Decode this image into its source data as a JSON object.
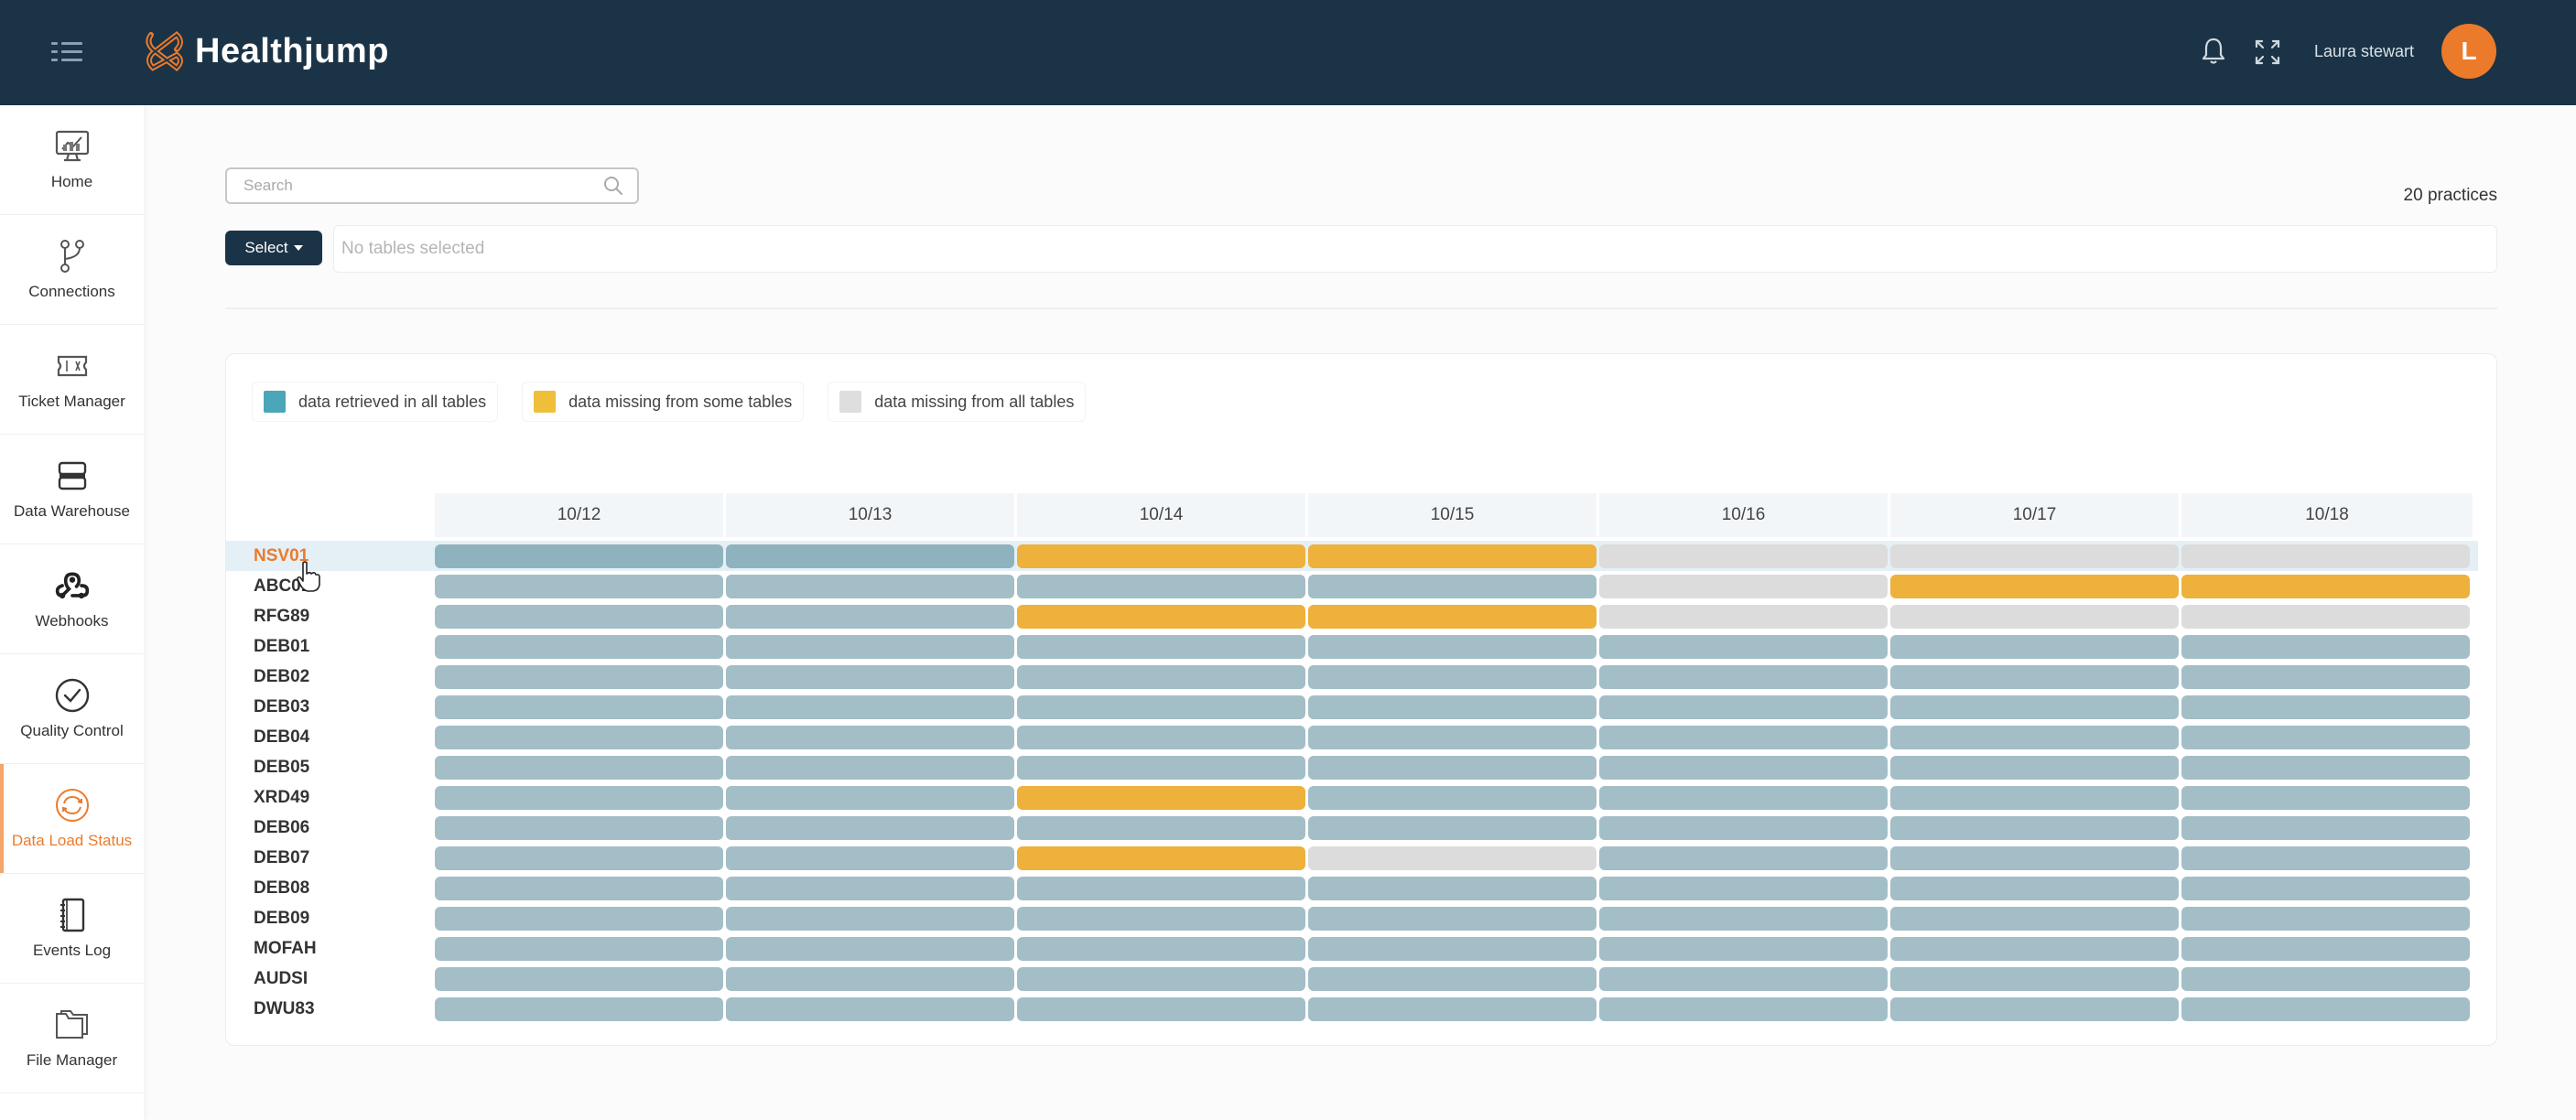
{
  "header": {
    "brand": "Healthjump",
    "user_name": "Laura stewart",
    "avatar_initial": "L",
    "icons": [
      "menu-icon",
      "bell-icon",
      "expand-icon"
    ]
  },
  "sidebar": {
    "items": [
      {
        "label": "Home",
        "icon": "monitor-chart-icon",
        "active": false
      },
      {
        "label": "Connections",
        "icon": "branch-icon",
        "active": false
      },
      {
        "label": "Ticket Manager",
        "icon": "ticket-icon",
        "active": false
      },
      {
        "label": "Data Warehouse",
        "icon": "server-icon",
        "active": false
      },
      {
        "label": "Webhooks",
        "icon": "webhook-icon",
        "active": false
      },
      {
        "label": "Quality Control",
        "icon": "check-circle-icon",
        "active": false
      },
      {
        "label": "Data Load Status",
        "icon": "sync-icon",
        "active": true
      },
      {
        "label": "Events Log",
        "icon": "notebook-icon",
        "active": false
      },
      {
        "label": "File Manager",
        "icon": "folder-icon",
        "active": false
      }
    ]
  },
  "toolbar": {
    "search_placeholder": "Search",
    "practice_count": "20 practices",
    "select_label": "Select",
    "tables_placeholder": "No tables selected"
  },
  "colors": {
    "brand_dark": "#1b3346",
    "accent": "#ec7a2b",
    "retrieved": "#a3bec7",
    "retrieved_legend": "#4aa6b8",
    "missing_some": "#edb13c",
    "missing_all": "#dcdcdc"
  },
  "legend": [
    {
      "key": "ok",
      "label": "data retrieved in all tables",
      "color": "#4aa6b8"
    },
    {
      "key": "some",
      "label": "data missing from some tables",
      "color": "#f0bf3a"
    },
    {
      "key": "none",
      "label": "data missing from all tables",
      "color": "#dedede"
    }
  ],
  "status_grid": {
    "dates": [
      "10/12",
      "10/13",
      "10/14",
      "10/15",
      "10/16",
      "10/17",
      "10/18"
    ],
    "hovered_practice": "NSV01",
    "practices": [
      {
        "name": "NSV01",
        "status": [
          "ok",
          "ok",
          "some",
          "some",
          "none",
          "none",
          "none"
        ]
      },
      {
        "name": "ABC01",
        "status": [
          "ok",
          "ok",
          "ok",
          "ok",
          "none",
          "some",
          "some"
        ]
      },
      {
        "name": "RFG89",
        "status": [
          "ok",
          "ok",
          "some",
          "some",
          "none",
          "none",
          "none"
        ]
      },
      {
        "name": "DEB01",
        "status": [
          "ok",
          "ok",
          "ok",
          "ok",
          "ok",
          "ok",
          "ok"
        ]
      },
      {
        "name": "DEB02",
        "status": [
          "ok",
          "ok",
          "ok",
          "ok",
          "ok",
          "ok",
          "ok"
        ]
      },
      {
        "name": "DEB03",
        "status": [
          "ok",
          "ok",
          "ok",
          "ok",
          "ok",
          "ok",
          "ok"
        ]
      },
      {
        "name": "DEB04",
        "status": [
          "ok",
          "ok",
          "ok",
          "ok",
          "ok",
          "ok",
          "ok"
        ]
      },
      {
        "name": "DEB05",
        "status": [
          "ok",
          "ok",
          "ok",
          "ok",
          "ok",
          "ok",
          "ok"
        ]
      },
      {
        "name": "XRD49",
        "status": [
          "ok",
          "ok",
          "some",
          "ok",
          "ok",
          "ok",
          "ok"
        ]
      },
      {
        "name": "DEB06",
        "status": [
          "ok",
          "ok",
          "ok",
          "ok",
          "ok",
          "ok",
          "ok"
        ]
      },
      {
        "name": "DEB07",
        "status": [
          "ok",
          "ok",
          "some",
          "none",
          "ok",
          "ok",
          "ok"
        ]
      },
      {
        "name": "DEB08",
        "status": [
          "ok",
          "ok",
          "ok",
          "ok",
          "ok",
          "ok",
          "ok"
        ]
      },
      {
        "name": "DEB09",
        "status": [
          "ok",
          "ok",
          "ok",
          "ok",
          "ok",
          "ok",
          "ok"
        ]
      },
      {
        "name": "MOFAH",
        "status": [
          "ok",
          "ok",
          "ok",
          "ok",
          "ok",
          "ok",
          "ok"
        ]
      },
      {
        "name": "AUDSI",
        "status": [
          "ok",
          "ok",
          "ok",
          "ok",
          "ok",
          "ok",
          "ok"
        ]
      },
      {
        "name": "DWU83",
        "status": [
          "ok",
          "ok",
          "ok",
          "ok",
          "ok",
          "ok",
          "ok"
        ]
      }
    ]
  }
}
